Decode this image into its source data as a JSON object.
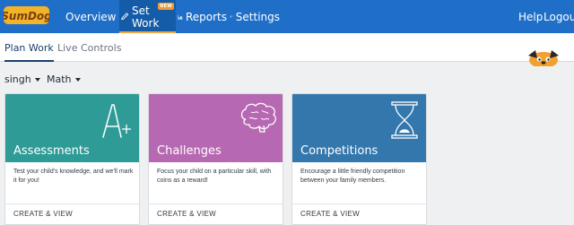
{
  "brand": {
    "logo_text": "SumDog"
  },
  "nav": {
    "items": [
      {
        "label": "Overview",
        "icon": "people-icon"
      },
      {
        "label": "Set Work",
        "icon": "pencil-icon",
        "badge": "NEW"
      },
      {
        "label": "Reports",
        "icon": "bar-chart-icon"
      },
      {
        "label": "Settings",
        "icon": "gears-icon"
      }
    ],
    "right": [
      {
        "label": "Help"
      },
      {
        "label": "Logout"
      }
    ]
  },
  "subnav": {
    "tabs": [
      {
        "label": "Plan Work"
      },
      {
        "label": "Live Controls"
      }
    ]
  },
  "filters": {
    "student": "singh",
    "subject": "Math"
  },
  "cards": [
    {
      "title": "Assessments",
      "description": "Test your child's knowledge, and we'll mark it for you!",
      "action": "CREATE & VIEW",
      "icon": "a-plus-icon",
      "color": "#2e9b96"
    },
    {
      "title": "Challenges",
      "description": "Focus your child on a particular skill, with coins as a reward!",
      "action": "CREATE & VIEW",
      "icon": "brain-icon",
      "color": "#b768b2"
    },
    {
      "title": "Competitions",
      "description": "Encourage a little friendly competition between your family members.",
      "action": "CREATE & VIEW",
      "icon": "hourglass-icon",
      "color": "#3477ad"
    }
  ],
  "colors": {
    "nav_bg": "#1f6fc8",
    "accent": "#f39a2e"
  }
}
